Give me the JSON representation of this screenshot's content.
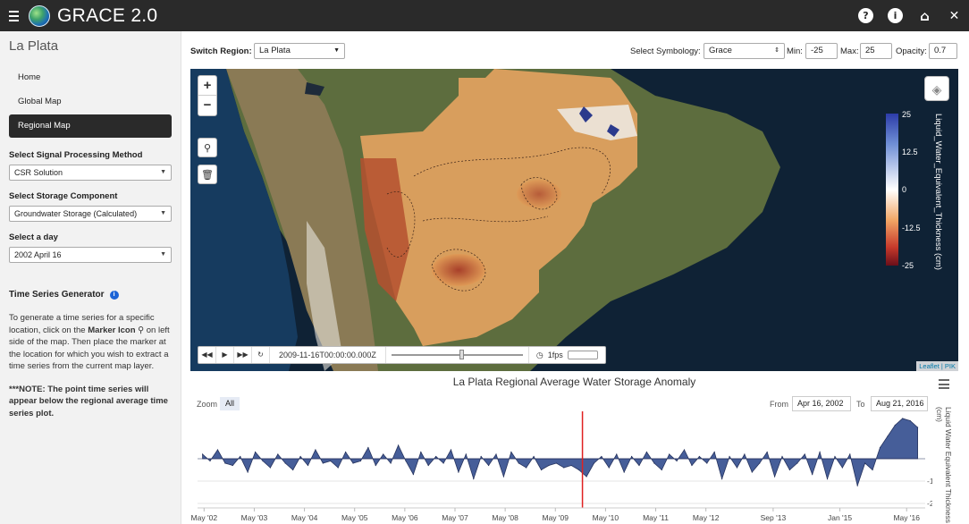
{
  "app": {
    "title": "GRACE 2.0"
  },
  "top_icons": [
    "help-icon",
    "info-icon",
    "home-icon",
    "close-icon"
  ],
  "sidebar": {
    "region": "La Plata",
    "nav": [
      {
        "label": "Home",
        "active": false
      },
      {
        "label": "Global Map",
        "active": false
      },
      {
        "label": "Regional Map",
        "active": true
      }
    ],
    "signal_label": "Select Signal Processing Method",
    "signal_value": "CSR Solution",
    "storage_label": "Select Storage Component",
    "storage_value": "Groundwater Storage (Calculated)",
    "day_label": "Select a day",
    "day_value": "2002 April 16",
    "ts_title": "Time Series Generator",
    "ts_text_1": "To generate a time series for a specific location, click on the",
    "ts_text_bold": "Marker Icon",
    "ts_text_2": "on left side of the map. Then place the marker at the location for which you wish to extract a time series from the current map layer.",
    "note": "***NOTE: The point time series will appear below the regional average time series plot."
  },
  "controls": {
    "switch_region_label": "Switch Region:",
    "switch_region_value": "La Plata",
    "symbology_label": "Select Symbology:",
    "symbology_value": "Grace",
    "min_label": "Min:",
    "min_value": "-25",
    "max_label": "Max:",
    "max_value": "25",
    "opacity_label": "Opacity:",
    "opacity_value": "0.7"
  },
  "map": {
    "legend_ticks": [
      "25",
      "12.5",
      "0",
      "-12.5",
      "-25"
    ],
    "legend_title": "Liquid_Water_Equivalent_Thickness (cm)",
    "timestamp": "2009-11-16T00:00:00.000Z",
    "fps": "1fps",
    "attribution": "Leaflet | PIK"
  },
  "chart": {
    "title": "La Plata Regional Average Water Storage Anomaly",
    "zoom_label": "Zoom",
    "zoom_all": "All",
    "from_label": "From",
    "from_value": "Apr 16, 2002",
    "to_label": "To",
    "to_value": "Aug 21, 2016",
    "y_label": "Liquid Water Equivalent Thickness (cm)"
  },
  "chart_data": {
    "type": "area",
    "title": "La Plata Regional Average Water Storage Anomaly",
    "ylabel": "Liquid Water Equivalent Thickness (cm)",
    "ylim": [
      -22,
      18
    ],
    "y_ticks": [
      -10,
      -20
    ],
    "x_ticks": [
      "May '02",
      "May '03",
      "May '04",
      "May '05",
      "May '06",
      "May '07",
      "May '08",
      "May '09",
      "May '10",
      "May '11",
      "May '12",
      "Sep '13",
      "Jan '15",
      "May '16"
    ],
    "x_tick_years": [
      2002.33,
      2003.33,
      2004.33,
      2005.33,
      2006.33,
      2007.33,
      2008.33,
      2009.33,
      2010.33,
      2011.33,
      2012.33,
      2013.67,
      2015.0,
      2016.33
    ],
    "xlim": [
      2002.2,
      2016.7
    ],
    "marker_year": 2009.87,
    "series": [
      {
        "color": "#3c5593",
        "x": [
          2002.3,
          2002.45,
          2002.6,
          2002.75,
          2002.9,
          2003.05,
          2003.2,
          2003.35,
          2003.5,
          2003.65,
          2003.8,
          2003.95,
          2004.1,
          2004.25,
          2004.4,
          2004.55,
          2004.7,
          2004.85,
          2005.0,
          2005.15,
          2005.3,
          2005.45,
          2005.6,
          2005.75,
          2005.9,
          2006.05,
          2006.2,
          2006.35,
          2006.5,
          2006.65,
          2006.8,
          2006.95,
          2007.1,
          2007.25,
          2007.4,
          2007.55,
          2007.7,
          2007.85,
          2008.0,
          2008.15,
          2008.3,
          2008.45,
          2008.6,
          2008.75,
          2008.9,
          2009.05,
          2009.2,
          2009.35,
          2009.5,
          2009.65,
          2009.8,
          2009.95,
          2010.1,
          2010.25,
          2010.4,
          2010.55,
          2010.7,
          2010.85,
          2011.0,
          2011.15,
          2011.3,
          2011.45,
          2011.6,
          2011.75,
          2011.9,
          2012.05,
          2012.2,
          2012.35,
          2012.5,
          2012.65,
          2012.8,
          2012.95,
          2013.1,
          2013.25,
          2013.4,
          2013.55,
          2013.7,
          2013.85,
          2014.0,
          2014.15,
          2014.3,
          2014.45,
          2014.6,
          2014.75,
          2014.9,
          2015.05,
          2015.2,
          2015.35,
          2015.5,
          2015.65,
          2015.8,
          2015.95,
          2016.1,
          2016.25,
          2016.4,
          2016.55
        ],
        "y": [
          2,
          -1,
          4,
          -2,
          -3,
          1,
          -6,
          3,
          -1,
          -4,
          2,
          -2,
          -5,
          1,
          -3,
          4,
          -2,
          -1,
          -4,
          3,
          -2,
          -1,
          5,
          -3,
          2,
          -2,
          6,
          -1,
          -7,
          3,
          -3,
          1,
          -2,
          4,
          -6,
          2,
          -9,
          1,
          -3,
          2,
          -8,
          3,
          -2,
          -4,
          1,
          -5,
          -3,
          -2,
          -4,
          -3,
          -5,
          -8,
          -2,
          1,
          -4,
          2,
          -6,
          1,
          -3,
          3,
          -2,
          -5,
          2,
          -1,
          4,
          -3,
          1,
          -2,
          3,
          -9,
          1,
          -4,
          2,
          -6,
          -2,
          3,
          -8,
          1,
          -5,
          -2,
          2,
          -7,
          3,
          -9,
          1,
          -4,
          2,
          -12,
          -2,
          -5,
          5,
          10,
          15,
          18,
          17,
          14
        ]
      }
    ]
  }
}
